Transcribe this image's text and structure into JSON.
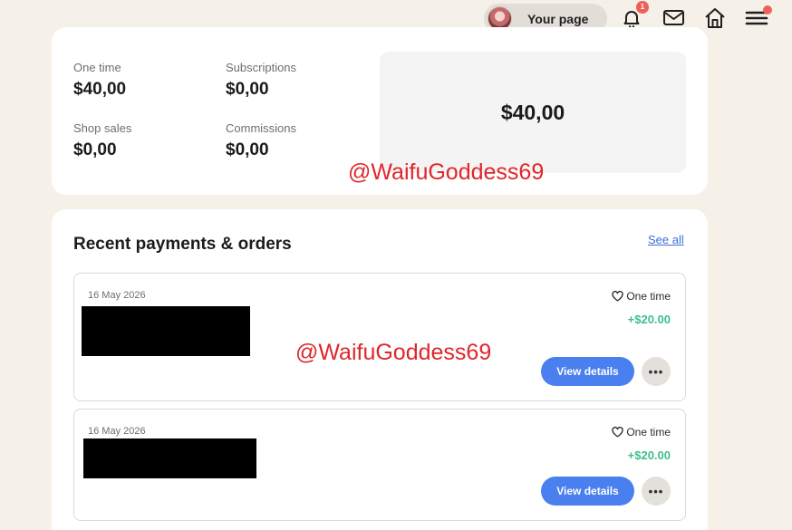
{
  "header": {
    "profile_label": "Your page",
    "notification_count": "1",
    "icons": [
      "bell-icon",
      "mail-icon",
      "home-icon",
      "menu-icon"
    ]
  },
  "summary": {
    "one_time": {
      "label": "One time",
      "value": "$40,00"
    },
    "subscriptions": {
      "label": "Subscriptions",
      "value": "$0,00"
    },
    "shop_sales": {
      "label": "Shop sales",
      "value": "$0,00"
    },
    "commissions": {
      "label": "Commissions",
      "value": "$0,00"
    },
    "total": "$40,00"
  },
  "recent": {
    "title": "Recent payments & orders",
    "see_all": "See all",
    "orders": [
      {
        "date": "16 May 2026",
        "type": "One time",
        "amount": "+$20.00",
        "view_label": "View details",
        "more_label": "•••"
      },
      {
        "date": "16 May 2026",
        "type": "One time",
        "amount": "+$20.00",
        "view_label": "View details",
        "more_label": "•••"
      }
    ]
  },
  "watermark": "@WaifuGoddess69",
  "colors": {
    "background": "#f5f0e8",
    "accent_blue": "#4a7ff0",
    "amount_green": "#3fbf8a",
    "badge_red": "#f0605a",
    "watermark_red": "#e0262a"
  }
}
